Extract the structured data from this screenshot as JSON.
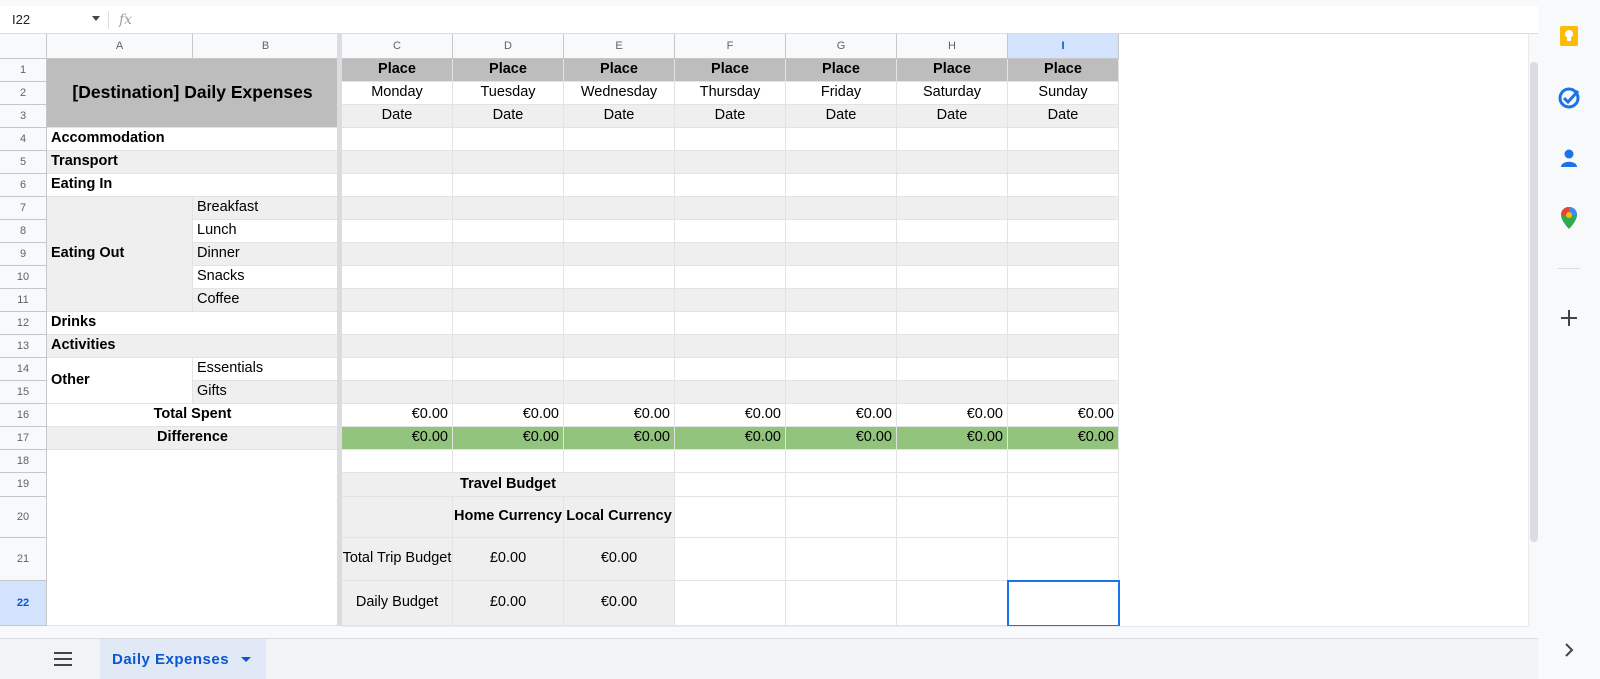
{
  "formula_bar": {
    "cell_ref": "I22",
    "fx_label": "fx",
    "formula": ""
  },
  "columns": [
    "A",
    "B",
    "C",
    "D",
    "E",
    "F",
    "G",
    "H",
    "I"
  ],
  "rows": [
    "1",
    "2",
    "3",
    "4",
    "5",
    "6",
    "7",
    "8",
    "9",
    "10",
    "11",
    "12",
    "13",
    "14",
    "15",
    "16",
    "17",
    "18",
    "19",
    "20",
    "21",
    "22"
  ],
  "title": "[Destination] Daily Expenses",
  "day_headers": {
    "place": "Place",
    "date": "Date",
    "days": [
      "Monday",
      "Tuesday",
      "Wednesday",
      "Thursday",
      "Friday",
      "Saturday",
      "Sunday"
    ]
  },
  "categories": {
    "accommodation": "Accommodation",
    "transport": "Transport",
    "eating_in": "Eating In",
    "eating_out": "Eating Out",
    "eating_out_items": [
      "Breakfast",
      "Lunch",
      "Dinner",
      "Snacks",
      "Coffee"
    ],
    "drinks": "Drinks",
    "activities": "Activities",
    "other": "Other",
    "other_items": [
      "Essentials",
      "Gifts"
    ],
    "total_spent": "Total Spent",
    "difference": "Difference"
  },
  "totals": {
    "total_spent": [
      "€0.00",
      "€0.00",
      "€0.00",
      "€0.00",
      "€0.00",
      "€0.00",
      "€0.00"
    ],
    "difference": [
      "€0.00",
      "€0.00",
      "€0.00",
      "€0.00",
      "€0.00",
      "€0.00",
      "€0.00"
    ]
  },
  "budget": {
    "title": "Travel Budget",
    "home_currency": "Home Currency",
    "local_currency": "Local Currency",
    "total_trip_budget": "Total Trip Budget",
    "daily_budget": "Daily Budget",
    "total_home": "£0.00",
    "total_local": "€0.00",
    "daily_home": "£0.00",
    "daily_local": "€0.00"
  },
  "sheet_tab": {
    "label": "Daily Expenses"
  },
  "colors": {
    "header_gray": "#bdbdbd",
    "light_gray": "#efefef",
    "difference_green": "#93c47d",
    "selection_blue": "#1a73e8"
  },
  "side_panel_icons": [
    "keep-icon",
    "tasks-icon",
    "contacts-icon",
    "maps-icon",
    "add-icon"
  ]
}
